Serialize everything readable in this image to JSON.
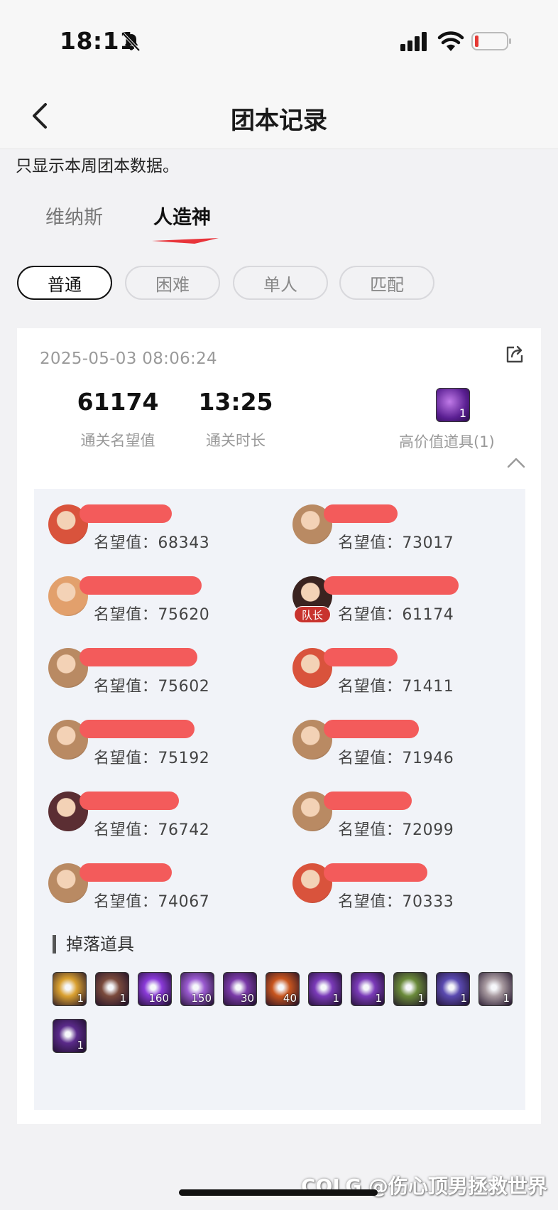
{
  "status_bar": {
    "time": "18:11"
  },
  "nav": {
    "title": "团本记录"
  },
  "notice": "只显示本周团本数据。",
  "raid_tabs": [
    {
      "label": "维纳斯",
      "active": false
    },
    {
      "label": "人造神",
      "active": true
    }
  ],
  "difficulty_pills": [
    {
      "label": "普通",
      "active": true
    },
    {
      "label": "困难",
      "active": false
    },
    {
      "label": "单人",
      "active": false
    },
    {
      "label": "匹配",
      "active": false
    }
  ],
  "record": {
    "timestamp": "2025-05-03 08:06:24",
    "clear_fame": {
      "value": "61174",
      "label": "通关名望值"
    },
    "clear_time": {
      "value": "13:25",
      "label": "通关时长"
    },
    "high_value": {
      "label": "高价值道具(1)",
      "count": "1"
    }
  },
  "members": [
    {
      "fame": "名望值：68343",
      "avatar_color": "#d9533c",
      "leader": false
    },
    {
      "fame": "名望值：73017",
      "avatar_color": "#b98a63",
      "leader": false
    },
    {
      "fame": "名望值：75620",
      "avatar_color": "#e2a06c",
      "leader": false
    },
    {
      "fame": "名望值：61174",
      "avatar_color": "#3a2320",
      "leader": true,
      "leader_label": "队长"
    },
    {
      "fame": "名望值：75602",
      "avatar_color": "#b98a63",
      "leader": false
    },
    {
      "fame": "名望值：71411",
      "avatar_color": "#d9533c",
      "leader": false
    },
    {
      "fame": "名望值：75192",
      "avatar_color": "#b98a63",
      "leader": false
    },
    {
      "fame": "名望值：71946",
      "avatar_color": "#b98a63",
      "leader": false
    },
    {
      "fame": "名望值：76742",
      "avatar_color": "#5b2e33",
      "leader": false
    },
    {
      "fame": "名望值：72099",
      "avatar_color": "#b98a63",
      "leader": false
    },
    {
      "fame": "名望值：74067",
      "avatar_color": "#b98a63",
      "leader": false
    },
    {
      "fame": "名望值：70333",
      "avatar_color": "#d9533c",
      "leader": false
    }
  ],
  "drops": {
    "title": "掉落道具",
    "items": [
      {
        "count": "1",
        "color": "#d9a030"
      },
      {
        "count": "1",
        "color": "#7a4a3c"
      },
      {
        "count": "160",
        "color": "#8a3ad8"
      },
      {
        "count": "150",
        "color": "#9a5ad0"
      },
      {
        "count": "30",
        "color": "#7a3aa8"
      },
      {
        "count": "40",
        "color": "#c8551e"
      },
      {
        "count": "1",
        "color": "#7a3ab8"
      },
      {
        "count": "1",
        "color": "#7a3ab8"
      },
      {
        "count": "1",
        "color": "#6a8a3a"
      },
      {
        "count": "1",
        "color": "#5a4ab0"
      },
      {
        "count": "1",
        "color": "#a89aa0"
      },
      {
        "count": "1",
        "color": "#5a2a8a"
      }
    ]
  },
  "watermark": "COLG @伤心顶男拯救世界"
}
